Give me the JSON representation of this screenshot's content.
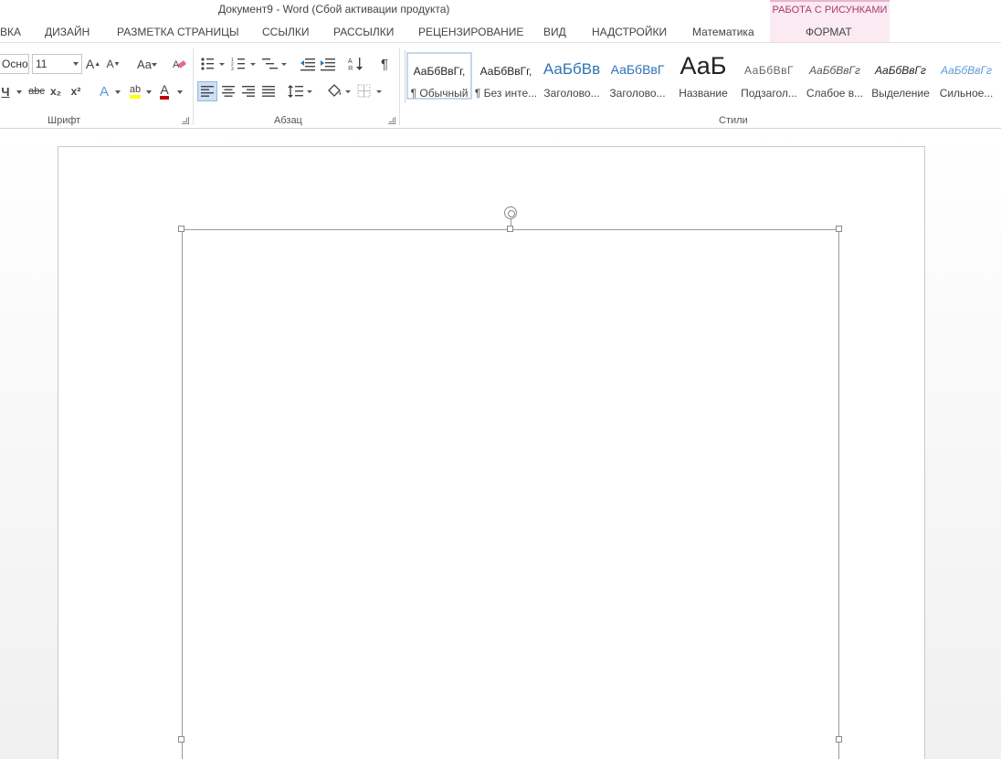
{
  "window": {
    "title": "Документ9 - Word (Сбой активации продукта)"
  },
  "context_tab_group": {
    "label": "РАБОТА С РИСУНКАМИ",
    "tab": "ФОРМАТ",
    "color": "#a53a6e"
  },
  "tabs": [
    "ВКА",
    "ДИЗАЙН",
    "РАЗМЕТКА СТРАНИЦЫ",
    "ССЫЛКИ",
    "РАССЫЛКИ",
    "РЕЦЕНЗИРОВАНИЕ",
    "ВИД",
    "НАДСТРОЙКИ",
    "Математика"
  ],
  "font_group": {
    "label": "Шрифт",
    "font_name": "Осно",
    "font_size": "11",
    "grow_font": "A",
    "shrink_font": "A",
    "change_case": "Aa",
    "underline": "Ч",
    "strikethrough": "abc",
    "subscript": "x₂",
    "superscript": "x²",
    "text_effects": "A",
    "highlight": "ab",
    "font_color": "A"
  },
  "paragraph_group": {
    "label": "Абзац",
    "show_marks": "¶"
  },
  "styles_group": {
    "label": "Стили",
    "items": [
      {
        "sample": "АаБбВвГг,",
        "name": "¶ Обычный"
      },
      {
        "sample": "АаБбВвГг,",
        "name": "¶ Без инте..."
      },
      {
        "sample": "АаБбВв",
        "name": "Заголово..."
      },
      {
        "sample": "АаБбВвГ",
        "name": "Заголово..."
      },
      {
        "sample": "АаБ",
        "name": "Название"
      },
      {
        "sample": "АаБбВвГ",
        "name": "Подзагол..."
      },
      {
        "sample": "АаБбВвГг",
        "name": "Слабое в..."
      },
      {
        "sample": "АаБбВвГг",
        "name": "Выделение"
      },
      {
        "sample": "АаБбВвГг",
        "name": "Сильное..."
      }
    ]
  },
  "colors": {
    "heading_blue": "#2e74b5",
    "highlight_yellow": "#ffff00",
    "font_color_red": "#c00000",
    "selection_blue": "#cde0f4"
  }
}
